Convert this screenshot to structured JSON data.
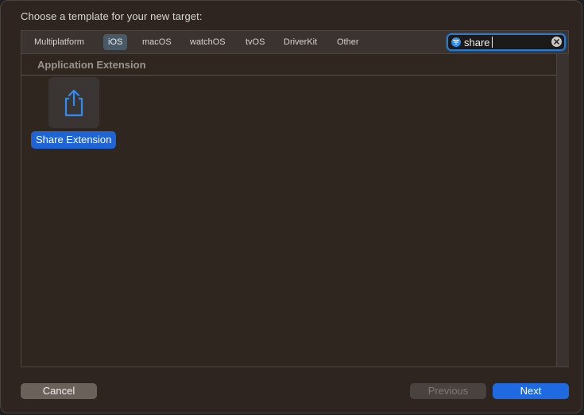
{
  "sheet": {
    "title": "Choose a template for your new target:"
  },
  "tabs": [
    {
      "label": "Multiplatform",
      "selected": false
    },
    {
      "label": "iOS",
      "selected": true
    },
    {
      "label": "macOS",
      "selected": false
    },
    {
      "label": "watchOS",
      "selected": false
    },
    {
      "label": "tvOS",
      "selected": false
    },
    {
      "label": "DriverKit",
      "selected": false
    },
    {
      "label": "Other",
      "selected": false
    }
  ],
  "search": {
    "value": "share",
    "icon": "filter-icon",
    "clear_icon": "clear-icon"
  },
  "section": {
    "label": "Application Extension"
  },
  "templates": [
    {
      "label": "Share Extension",
      "icon": "share-icon",
      "selected": true
    }
  ],
  "buttons": {
    "cancel": "Cancel",
    "previous": "Previous",
    "next": "Next"
  },
  "colors": {
    "accent": "#1f6ae0",
    "background": "#2e2520",
    "selected_tab": "#4a5966"
  }
}
